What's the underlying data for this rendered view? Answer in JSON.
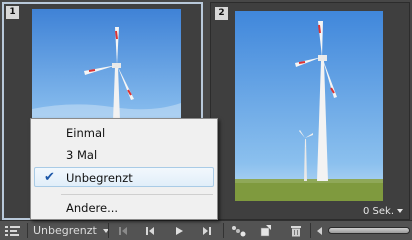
{
  "frames": [
    {
      "number": "1",
      "delay": ""
    },
    {
      "number": "2",
      "delay": "0 Sek."
    }
  ],
  "menu": {
    "items": [
      {
        "label": "Einmal",
        "checked": false
      },
      {
        "label": "3 Mal",
        "checked": false
      },
      {
        "label": "Unbegrenzt",
        "checked": true
      },
      {
        "label": "Andere...",
        "checked": false
      }
    ]
  },
  "toolbar": {
    "loop_value": "Unbegrenzt",
    "icons": [
      "timeline-convert-icon",
      "first-frame-icon",
      "previous-frame-icon",
      "play-icon",
      "next-frame-icon",
      "tween-icon",
      "duplicate-frame-icon",
      "delete-icon",
      "zoom-slider"
    ]
  },
  "colors": {
    "panel": "#474747",
    "selected_frame_border": "#b9c9da",
    "menu_bg": "#f0f0f0",
    "menu_highlight": "#e1eef9",
    "check": "#1c57a8"
  }
}
